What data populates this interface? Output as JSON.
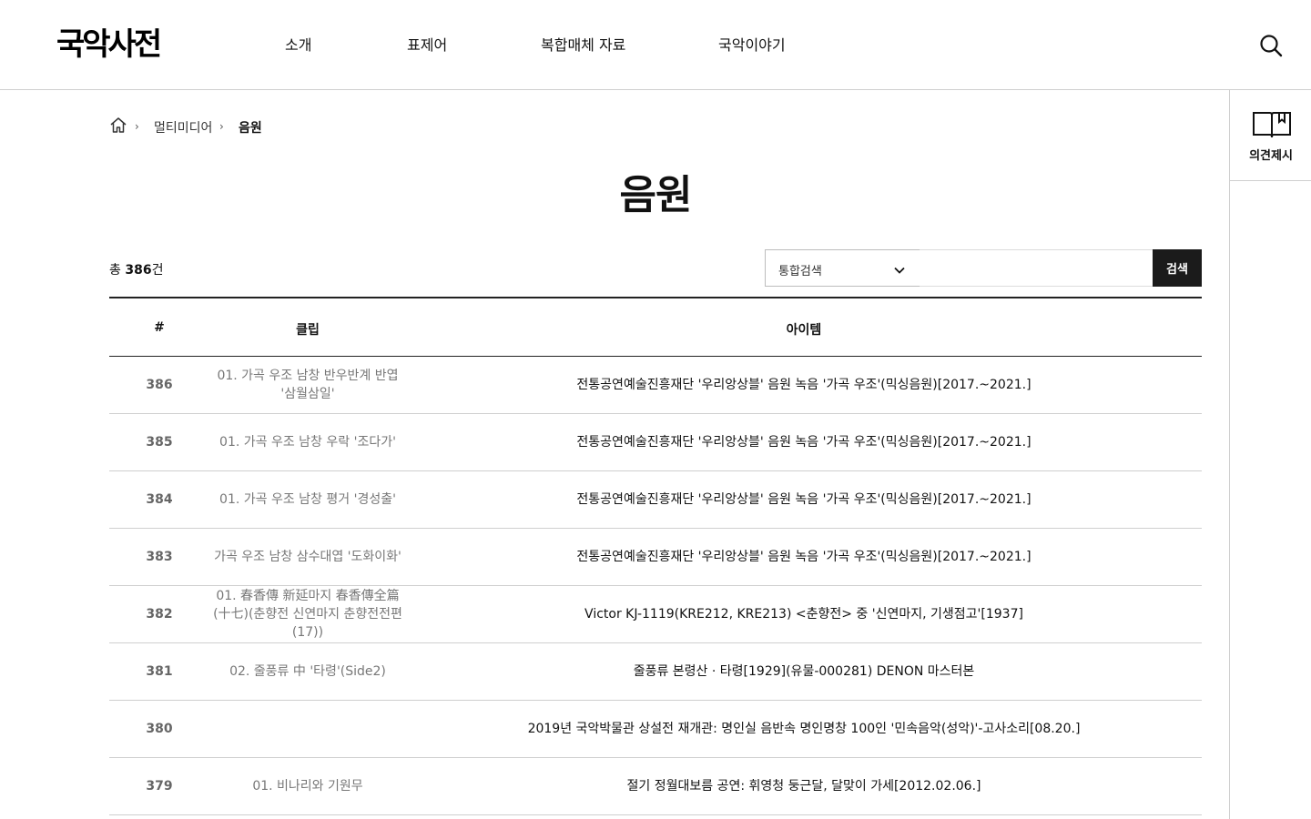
{
  "header": {
    "logo": "국악사전",
    "nav": [
      "소개",
      "표제어",
      "복합매체 자료",
      "국악이야기"
    ]
  },
  "quick": {
    "label": "의견제시"
  },
  "breadcrumb": {
    "parent": "멀티미디어",
    "current": "음원"
  },
  "page_title": "음원",
  "total": {
    "prefix": "총",
    "count": "386",
    "suffix": "건"
  },
  "search": {
    "select_value": "통합검색",
    "input_value": "",
    "button": "검색"
  },
  "table": {
    "headers": [
      "#",
      "클립",
      "아이템"
    ],
    "rows": [
      {
        "num": "386",
        "clip": "01. 가곡 우조 남창 반우반계 반엽 '삼월삼일'",
        "item": "전통공연예술진흥재단 '우리앙상블' 음원 녹음 '가곡 우조'(믹싱음원)[2017.~2021.]"
      },
      {
        "num": "385",
        "clip": "01. 가곡 우조 남창 우락 '조다가'",
        "item": "전통공연예술진흥재단 '우리앙상블' 음원 녹음 '가곡 우조'(믹싱음원)[2017.~2021.]"
      },
      {
        "num": "384",
        "clip": "01. 가곡 우조 남창 평거 '경성출'",
        "item": "전통공연예술진흥재단 '우리앙상블' 음원 녹음 '가곡 우조'(믹싱음원)[2017.~2021.]"
      },
      {
        "num": "383",
        "clip": "가곡 우조 남창 삼수대엽 '도화이화'",
        "item": "전통공연예술진흥재단 '우리앙상블' 음원 녹음 '가곡 우조'(믹싱음원)[2017.~2021.]"
      },
      {
        "num": "382",
        "clip": "01. 春香傳 新延마지 春香傳全篇(十七)(춘향전 신연마지 춘향전전편(17))",
        "item": "Victor KJ-1119(KRE212, KRE213) <춘향전> 중 '신연마지, 기생점고'[1937]"
      },
      {
        "num": "381",
        "clip": "02. 줄풍류 中 '타령'(Side2)",
        "item": "줄풍류 본령산 · 타령[1929](유물-000281) DENON 마스터본"
      },
      {
        "num": "380",
        "clip": "",
        "item": "2019년 국악박물관 상설전 재개관: 명인실 음반속 명인명창 100인 '민속음악(성악)'-고사소리[08.20.]"
      },
      {
        "num": "379",
        "clip": "01. 비나리와 기원무",
        "item": "절기 정월대보름 공연: 휘영청 둥근달, 달맞이 가세[2012.02.06.]"
      }
    ]
  }
}
